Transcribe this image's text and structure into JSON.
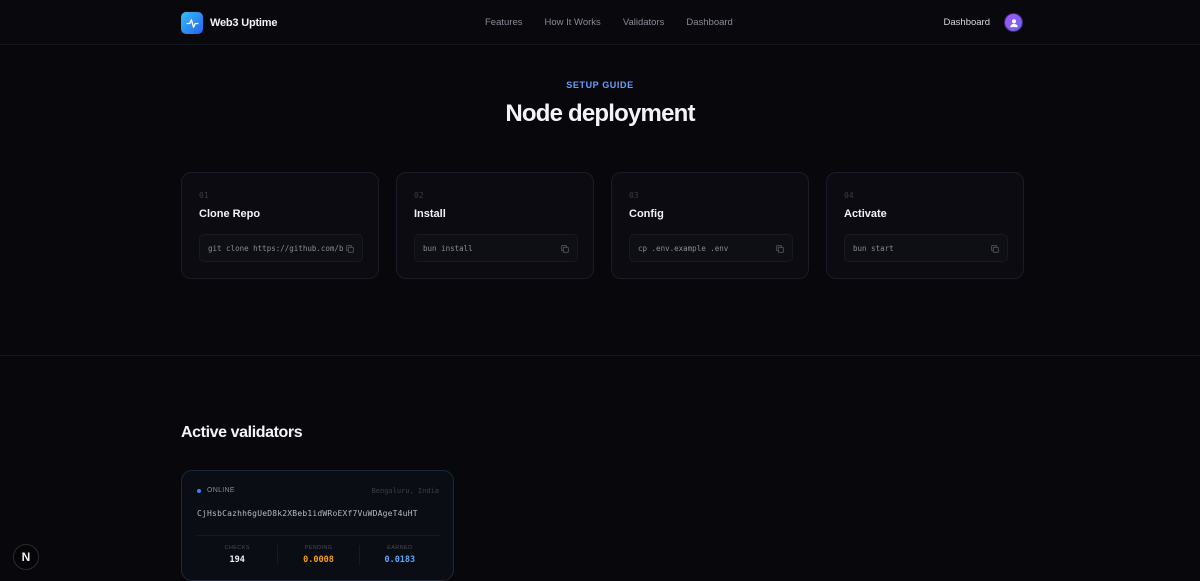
{
  "brand": {
    "name": "Web3 Uptime",
    "icon": "activity-pulse-icon"
  },
  "nav": {
    "links": [
      "Features",
      "How It Works",
      "Validators",
      "Dashboard"
    ],
    "dashboard_label": "Dashboard",
    "avatar_icon": "user-icon"
  },
  "setup": {
    "label": "SETUP GUIDE",
    "title": "Node deployment",
    "steps": [
      {
        "num": "01",
        "title": "Clone Repo",
        "command": "git clone https://github.com/b"
      },
      {
        "num": "02",
        "title": "Install",
        "command": "bun install"
      },
      {
        "num": "03",
        "title": "Config",
        "command": "cp .env.example .env"
      },
      {
        "num": "04",
        "title": "Activate",
        "command": "bun start"
      }
    ]
  },
  "validators": {
    "title": "Active validators",
    "items": [
      {
        "status": "ONLINE",
        "location": "Bengaluru, India",
        "key": "CjHsbCazhh6gUeD8k2XBeb1idWRoEXf7VuWDAgeT4uHT",
        "stats": [
          {
            "label": "CHECKS",
            "value": "194",
            "color": "#f2f2f6"
          },
          {
            "label": "PENDING",
            "value": "0.0008",
            "color": "#f59e0b"
          },
          {
            "label": "EARNED",
            "value": "0.0183",
            "color": "#60a5fa"
          }
        ]
      }
    ]
  },
  "colors": {
    "accent": "#6b9eff",
    "online": "#3b82f6",
    "pending": "#f59e0b",
    "earned": "#60a5fa"
  },
  "next_badge": {
    "label": "N"
  }
}
